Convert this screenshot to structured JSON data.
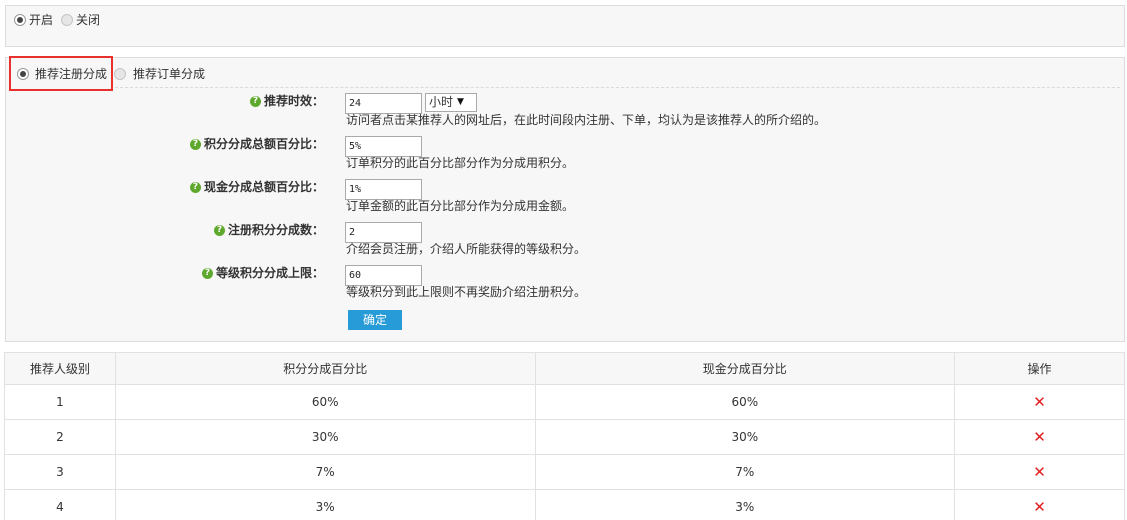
{
  "status_toggle": {
    "options": [
      {
        "label": "开启",
        "checked": true
      },
      {
        "label": "关闭",
        "checked": false
      }
    ]
  },
  "mode_toggle": {
    "options": [
      {
        "label": "推荐注册分成",
        "checked": true
      },
      {
        "label": "推荐订单分成",
        "checked": false
      }
    ]
  },
  "help_icon": "help-icon",
  "fields": {
    "valid_time": {
      "label": "推荐时效：",
      "value": "24",
      "unit_option": "小时",
      "hint": "访问者点击某推荐人的网址后，在此时间段内注册、下单，均认为是该推荐人的所介绍的。"
    },
    "points_percent": {
      "label": "积分分成总额百分比：",
      "value": "5%",
      "hint": "订单积分的此百分比部分作为分成用积分。"
    },
    "cash_percent": {
      "label": "现金分成总额百分比：",
      "value": "1%",
      "hint": "订单金额的此百分比部分作为分成用金额。"
    },
    "register_points": {
      "label": "注册积分分成数：",
      "value": "2",
      "hint": "介绍会员注册，介绍人所能获得的等级积分。"
    },
    "level_points_limit": {
      "label": "等级积分分成上限：",
      "value": "60",
      "hint": "等级积分到此上限则不再奖励介绍注册积分。"
    }
  },
  "confirm_label": "确定",
  "table": {
    "headers": [
      "推荐人级别",
      "积分分成百分比",
      "现金分成百分比",
      "操作"
    ],
    "rows": [
      {
        "level": "1",
        "points": "60%",
        "cash": "60%"
      },
      {
        "level": "2",
        "points": "30%",
        "cash": "30%"
      },
      {
        "level": "3",
        "points": "7%",
        "cash": "7%"
      },
      {
        "level": "4",
        "points": "3%",
        "cash": "3%"
      }
    ],
    "delete_glyph": "✕"
  },
  "colors": {
    "accent_button": "#279bd8",
    "highlight_border": "#e8312c",
    "help_icon": "#5fa82e",
    "delete_icon": "#e02020"
  }
}
